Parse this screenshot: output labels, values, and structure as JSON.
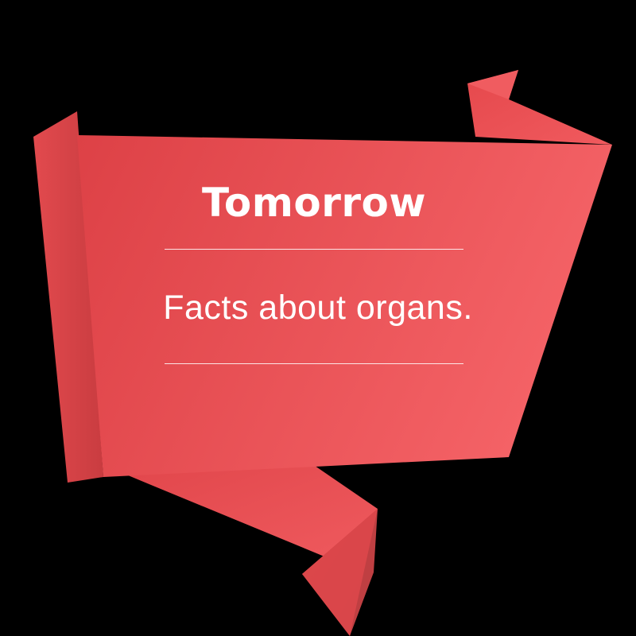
{
  "banner": {
    "title": "Tomorrow",
    "subtitle": "Facts about organs."
  },
  "colors": {
    "background": "#000000",
    "banner_main": "#e84e52",
    "banner_light": "#f46064",
    "banner_dark": "#b83438",
    "text": "#ffffff"
  }
}
